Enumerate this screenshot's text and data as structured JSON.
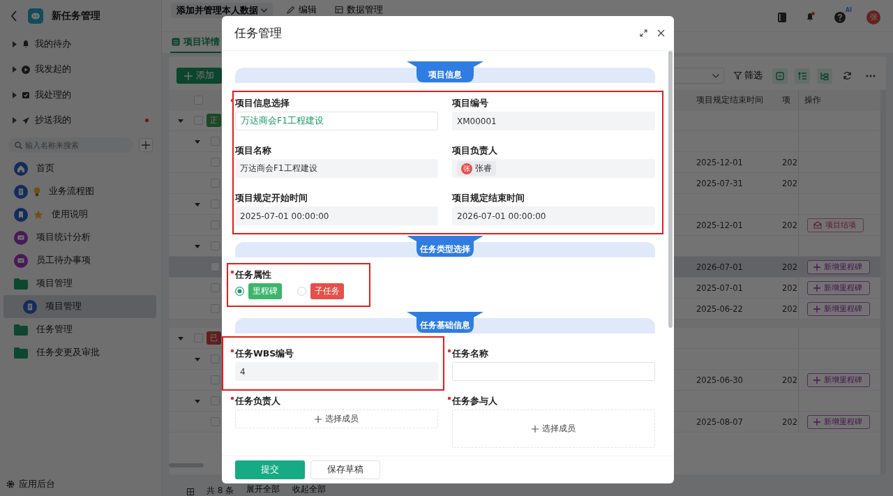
{
  "sidebar": {
    "title": "新任务管理",
    "inbox": [
      {
        "label": "我的待办",
        "kind": "bell",
        "unread": false
      },
      {
        "label": "我发起的",
        "kind": "play",
        "unread": false
      },
      {
        "label": "我处理的",
        "kind": "tray",
        "unread": false
      },
      {
        "label": "抄送我的",
        "kind": "send",
        "unread": true
      }
    ],
    "search": {
      "placeholder": "输入名称来搜索"
    },
    "nav": [
      {
        "label": "首页",
        "kind": "home",
        "selected": false
      },
      {
        "label": "业务流程图",
        "kind": "flow",
        "selected": false
      },
      {
        "label": "使用说明",
        "kind": "guide",
        "selected": false
      },
      {
        "label": "项目统计分析",
        "kind": "chart",
        "selected": false
      },
      {
        "label": "员工待办事项",
        "kind": "chart",
        "selected": false
      },
      {
        "label": "项目管理",
        "kind": "folder",
        "selected": false,
        "children": [
          {
            "label": "项目管理",
            "kind": "doc",
            "selected": true
          }
        ]
      },
      {
        "label": "任务管理",
        "kind": "folder",
        "selected": false
      },
      {
        "label": "任务变更及审批",
        "kind": "folder",
        "selected": false
      }
    ],
    "footer": "应用后台"
  },
  "topbar": {
    "view": "添加并管理本人数据",
    "actions": [
      {
        "label": "编辑",
        "kind": "pencil"
      },
      {
        "label": "数据管理",
        "kind": "table"
      }
    ],
    "ai_badge": "AI",
    "avatar": "张"
  },
  "tabs": [
    {
      "label": "项目详情",
      "selected": true
    }
  ],
  "toolbar": {
    "add": "添加",
    "filter": "筛选"
  },
  "table": {
    "columns": [
      "项目规定结束时间",
      "项",
      "操作"
    ],
    "all_checked": false,
    "groups": [
      {
        "tag": "正",
        "kind": "active",
        "expanded": true,
        "selected": false,
        "checked": false,
        "children": [
          {
            "expanded": true,
            "selected": false,
            "checked": false,
            "children": [
              {
                "end": "2025-12-01",
                "col": "202",
                "selected": false,
                "checked": false
              },
              {
                "end": "2025-07-31",
                "col": "202",
                "selected": false,
                "checked": false
              }
            ]
          },
          {
            "expanded": true,
            "selected": false,
            "checked": false,
            "children": [
              {
                "end": "2025-12-01",
                "col": "202",
                "selected": false,
                "checked": false,
                "action": {
                  "kind": "close",
                  "label": "项目结项"
                }
              }
            ]
          },
          {
            "expanded": true,
            "selected": false,
            "checked": false,
            "children": [
              {
                "end": "2026-07-01",
                "col": "202",
                "selected": true,
                "checked": false,
                "action": {
                  "kind": "milestone",
                  "label": "新增里程碑"
                }
              },
              {
                "end": "2025-07-01",
                "col": "202",
                "selected": false,
                "checked": false,
                "action": {
                  "kind": "milestone",
                  "label": "新增里程碑"
                }
              },
              {
                "end": "2025-06-22",
                "col": "202",
                "selected": false,
                "checked": false,
                "action": {
                  "kind": "milestone",
                  "label": "新增里程碑"
                }
              }
            ]
          }
        ]
      },
      {
        "tag": "已",
        "kind": "done",
        "expanded": true,
        "selected": false,
        "checked": false,
        "children": [
          {
            "expanded": true,
            "selected": false,
            "checked": false,
            "children": [
              {
                "end": "2025-06-30",
                "col": "202",
                "selected": false,
                "checked": false,
                "action": {
                  "kind": "milestone",
                  "label": "新增里程碑"
                }
              }
            ]
          },
          {
            "expanded": true,
            "selected": false,
            "checked": false,
            "children": [
              {
                "end": "2025-08-07",
                "col": "202",
                "selected": false,
                "checked": false,
                "action": {
                  "kind": "milestone",
                  "label": "新增里程碑"
                }
              }
            ]
          }
        ]
      }
    ]
  },
  "footer": {
    "total": "共 8 条",
    "expand": "展开全部",
    "collapse": "收起全部"
  },
  "dialog": {
    "title": "任务管理",
    "sections": [
      {
        "title": "项目信息",
        "fields": [
          {
            "label": "项目信息选择",
            "required": true,
            "kind": "select",
            "value": "万达商会F1工程建设"
          },
          {
            "label": "项目编号",
            "required": false,
            "kind": "readonly",
            "value": "XM00001"
          },
          {
            "label": "项目名称",
            "required": false,
            "kind": "readonly",
            "value": "万达商会F1工程建设"
          },
          {
            "label": "项目负责人",
            "required": false,
            "kind": "person",
            "avatar": "张",
            "value": "张睿"
          },
          {
            "label": "项目规定开始时间",
            "required": false,
            "kind": "readonly",
            "value": "2025-07-01 00:00:00"
          },
          {
            "label": "项目规定结束时间",
            "required": false,
            "kind": "readonly",
            "value": "2026-07-01 00:00:00"
          }
        ]
      },
      {
        "title": "任务类型选择",
        "fields": [
          {
            "label": "任务属性",
            "required": true,
            "kind": "radio",
            "options": [
              {
                "label": "里程碑",
                "color": "#3cb56b",
                "selected": true
              },
              {
                "label": "子任务",
                "color": "#e5504b",
                "selected": false
              }
            ]
          }
        ]
      },
      {
        "title": "任务基础信息",
        "fields": [
          {
            "label": "任务WBS编号",
            "required": true,
            "kind": "readonly",
            "value": "4"
          },
          {
            "label": "任务名称",
            "required": true,
            "kind": "input"
          },
          {
            "label": "任务负责人",
            "required": true,
            "kind": "member",
            "button": "选择成员"
          },
          {
            "label": "任务参与人",
            "required": true,
            "kind": "members",
            "button": "选择成员"
          }
        ]
      }
    ],
    "buttons": [
      {
        "label": "提交",
        "kind": "primary"
      },
      {
        "label": "保存草稿",
        "kind": "default"
      }
    ]
  }
}
